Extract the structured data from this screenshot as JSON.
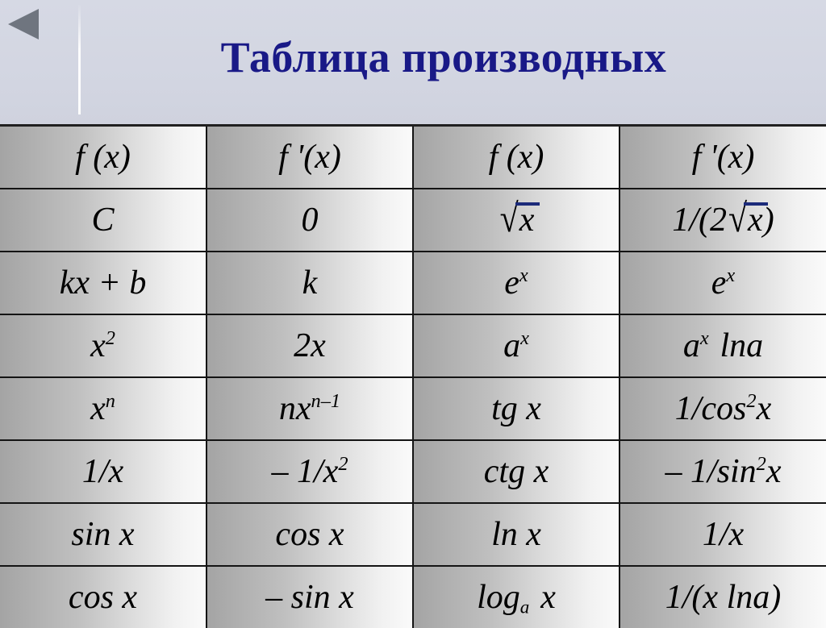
{
  "slide": {
    "title": "Таблица производных",
    "background_color": "#d3d6e2",
    "title_color": "#191987"
  },
  "nav": {
    "back_icon": "triangle-left-icon",
    "back_icon_color": "#6f757f"
  },
  "table": {
    "columns": [
      "f (x)",
      "f '(x)",
      "f (x)",
      "f '(x)"
    ],
    "rows": [
      {
        "fx_left": "C",
        "dfx_left": "0",
        "fx_right": "√x",
        "dfx_right": "1/(2√x)"
      },
      {
        "fx_left": "kx + b",
        "dfx_left": "k",
        "fx_right": "eˣ",
        "dfx_right": "eˣ"
      },
      {
        "fx_left": "x²",
        "dfx_left": "2x",
        "fx_right": "aˣ",
        "dfx_right": "aˣ lna"
      },
      {
        "fx_left": "xⁿ",
        "dfx_left": "nxⁿ⁻¹",
        "fx_right": "tg x",
        "dfx_right": "1/cos²x"
      },
      {
        "fx_left": "1/x",
        "dfx_left": "– 1/x²",
        "fx_right": "ctg x",
        "dfx_right": "– 1/sin²x"
      },
      {
        "fx_left": "sin x",
        "dfx_left": "cos x",
        "fx_right": "ln x",
        "dfx_right": "1/x"
      },
      {
        "fx_left": "cos x",
        "dfx_left": "– sin x",
        "fx_right": "logₐ x",
        "dfx_right": "1/(x lna)"
      }
    ],
    "parts": {
      "h1": "f (x)",
      "h2": "f '(x)",
      "h3": "f (x)",
      "h4": "f '(x)",
      "r1c1": "C",
      "r1c2": "0",
      "r1c3_arg": "x",
      "r1c4_pre": "1/(2",
      "r1c4_arg": "x",
      "r1c4_post": ")",
      "r2c1": "kx + b",
      "r2c2": "k",
      "r2c3_base": "e",
      "r2c3_exp": "x",
      "r2c4_base": "e",
      "r2c4_exp": "x",
      "r3c1_base": "x",
      "r3c1_exp": "2",
      "r3c2": "2x",
      "r3c3_base": "a",
      "r3c3_exp": "x",
      "r3c4_base": "a",
      "r3c4_exp": "x",
      "r3c4_tail": "lna",
      "r4c1_base": "x",
      "r4c1_exp": "n",
      "r4c2_base": "nx",
      "r4c2_exp": "n–1",
      "r4c3": "tg x",
      "r4c4_pre": "1/cos",
      "r4c4_exp": "2",
      "r4c4_post": "x",
      "r5c1": "1/x",
      "r5c2_pre": "– 1/x",
      "r5c2_exp": "2",
      "r5c3": "ctg x",
      "r5c4_pre": "– 1/sin",
      "r5c4_exp": "2",
      "r5c4_post": "x",
      "r6c1": "sin x",
      "r6c2": "cos x",
      "r6c3": "ln x",
      "r6c4": "1/x",
      "r7c1": "cos x",
      "r7c2": "– sin x",
      "r7c3_pre": "log",
      "r7c3_sub": "a",
      "r7c3_post": "x",
      "r7c4": "1/(x lna)",
      "radical_sign": "√"
    }
  }
}
